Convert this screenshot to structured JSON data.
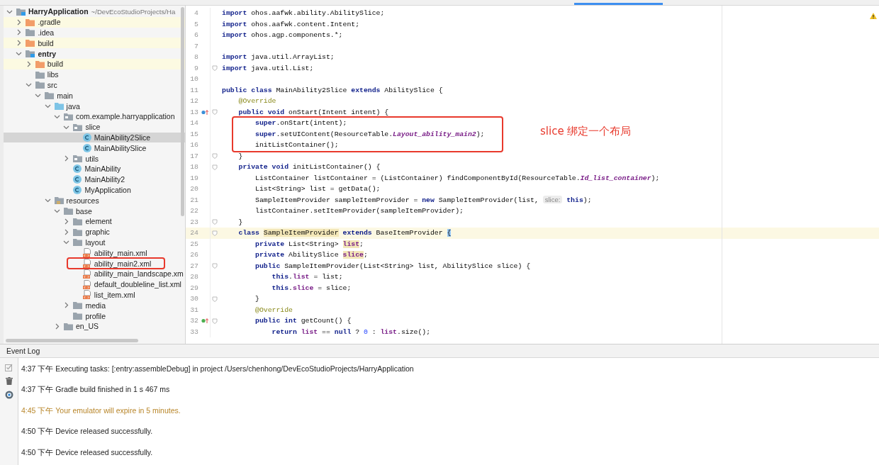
{
  "project_tree": {
    "items": [
      {
        "name": "HarryApplication",
        "path": "~/DevEcoStudioProjects/Ha",
        "kind": "module",
        "expanded": true,
        "selected": false,
        "children": [
          {
            "name": ".gradle",
            "kind": "excluded",
            "expanded": false,
            "selected": false
          },
          {
            "name": ".idea",
            "kind": "folder",
            "expanded": false,
            "selected": false
          },
          {
            "name": "build",
            "kind": "excluded",
            "expanded": false,
            "selected": false
          },
          {
            "name": "entry",
            "kind": "module",
            "expanded": true,
            "selected": false,
            "children": [
              {
                "name": "build",
                "kind": "excluded",
                "expanded": false,
                "selected": false
              },
              {
                "name": "libs",
                "kind": "folder",
                "selected": false
              },
              {
                "name": "src",
                "kind": "folder",
                "expanded": true,
                "selected": false,
                "children": [
                  {
                    "name": "main",
                    "kind": "folder",
                    "expanded": true,
                    "selected": false,
                    "children": [
                      {
                        "name": "java",
                        "kind": "source",
                        "expanded": true,
                        "selected": false,
                        "children": [
                          {
                            "name": "com.example.harryapplication",
                            "kind": "package",
                            "expanded": true,
                            "selected": false,
                            "children": [
                              {
                                "name": "slice",
                                "kind": "package",
                                "expanded": true,
                                "selected": false,
                                "children": [
                                  {
                                    "name": "MainAbility2Slice",
                                    "kind": "class",
                                    "selected": true
                                  },
                                  {
                                    "name": "MainAbilitySlice",
                                    "kind": "class",
                                    "selected": false
                                  }
                                ]
                              },
                              {
                                "name": "utils",
                                "kind": "package",
                                "expanded": false,
                                "selected": false
                              },
                              {
                                "name": "MainAbility",
                                "kind": "class",
                                "selected": false
                              },
                              {
                                "name": "MainAbility2",
                                "kind": "class",
                                "selected": false
                              },
                              {
                                "name": "MyApplication",
                                "kind": "class",
                                "selected": false
                              }
                            ]
                          }
                        ]
                      },
                      {
                        "name": "resources",
                        "kind": "resource",
                        "expanded": true,
                        "selected": false,
                        "children": [
                          {
                            "name": "base",
                            "kind": "folder",
                            "expanded": true,
                            "selected": false,
                            "children": [
                              {
                                "name": "element",
                                "kind": "folder",
                                "expanded": false,
                                "selected": false
                              },
                              {
                                "name": "graphic",
                                "kind": "folder",
                                "expanded": false,
                                "selected": false
                              },
                              {
                                "name": "layout",
                                "kind": "folder",
                                "expanded": true,
                                "selected": false,
                                "children": [
                                  {
                                    "name": "ability_main.xml",
                                    "kind": "xml",
                                    "selected": false
                                  },
                                  {
                                    "name": "ability_main2.xml",
                                    "kind": "xml",
                                    "selected": false,
                                    "boxed": true
                                  },
                                  {
                                    "name": "ability_main_landscape.xm",
                                    "kind": "xml",
                                    "selected": false
                                  },
                                  {
                                    "name": "default_doubleline_list.xml",
                                    "kind": "xml",
                                    "selected": false
                                  },
                                  {
                                    "name": "list_item.xml",
                                    "kind": "xml",
                                    "selected": false
                                  }
                                ]
                              },
                              {
                                "name": "media",
                                "kind": "folder",
                                "expanded": false,
                                "selected": false
                              },
                              {
                                "name": "profile",
                                "kind": "folder",
                                "selected": false
                              }
                            ]
                          },
                          {
                            "name": "en_US",
                            "kind": "folder",
                            "expanded": false,
                            "selected": false
                          }
                        ]
                      }
                    ]
                  }
                ]
              }
            ]
          }
        ]
      }
    ]
  },
  "editor": {
    "callout": "slice 绑定一个布局",
    "lines": [
      {
        "number": "4",
        "segments": [
          {
            "t": "import",
            "kind": "kw"
          },
          {
            "t": " ohos.aafwk.ability.AbilitySlice;",
            "kind": "p"
          }
        ]
      },
      {
        "number": "5",
        "segments": [
          {
            "t": "import",
            "kind": "kw"
          },
          {
            "t": " ohos.aafwk.content.Intent;",
            "kind": "p"
          }
        ]
      },
      {
        "number": "6",
        "segments": [
          {
            "t": "import",
            "kind": "kw"
          },
          {
            "t": " ohos.agp.components.*;",
            "kind": "p"
          }
        ]
      },
      {
        "number": "7"
      },
      {
        "number": "8",
        "segments": [
          {
            "t": "import",
            "kind": "kw"
          },
          {
            "t": " java.util.ArrayList;",
            "kind": "p"
          }
        ]
      },
      {
        "number": "9",
        "fold": true,
        "segments": [
          {
            "t": "import",
            "kind": "kw"
          },
          {
            "t": " java.util.List;",
            "kind": "p"
          }
        ]
      },
      {
        "number": "10"
      },
      {
        "number": "11",
        "segments": [
          {
            "t": "public class",
            "kind": "kw"
          },
          {
            "t": " MainAbility2Slice ",
            "kind": "p"
          },
          {
            "t": "extends",
            "kind": "kw"
          },
          {
            "t": " AbilitySlice {",
            "kind": "p"
          }
        ]
      },
      {
        "number": "12",
        "segments": [
          {
            "t": "    @Override",
            "kind": "ann"
          }
        ]
      },
      {
        "number": "13",
        "overrides": true,
        "fold": true,
        "segments": [
          {
            "t": "    public void",
            "kind": "kw"
          },
          {
            "t": " onStart(Intent intent) {",
            "kind": "p"
          }
        ]
      },
      {
        "number": "14",
        "boxed": true,
        "segments": [
          {
            "t": "        super",
            "kind": "kw"
          },
          {
            "t": ".onStart(intent);",
            "kind": "p"
          }
        ]
      },
      {
        "number": "15",
        "boxed": true,
        "segments": [
          {
            "t": "        super",
            "kind": "kw"
          },
          {
            "t": ".setUIContent(ResourceTable.",
            "kind": "p"
          },
          {
            "t": "Layout_ability_main2",
            "kind": "fld"
          },
          {
            "t": ");",
            "kind": "p"
          }
        ]
      },
      {
        "number": "16",
        "boxed": true,
        "segments": [
          {
            "t": "        initListContainer();",
            "kind": "p"
          }
        ]
      },
      {
        "number": "17",
        "fold": true,
        "segments": [
          {
            "t": "    }",
            "kind": "p"
          }
        ]
      },
      {
        "number": "18",
        "fold": true,
        "segments": [
          {
            "t": "    private void",
            "kind": "kw"
          },
          {
            "t": " initListContainer() {",
            "kind": "p"
          }
        ]
      },
      {
        "number": "19",
        "segments": [
          {
            "t": "        ListContainer listContainer = (ListContainer) findComponentById(ResourceTable.",
            "kind": "p"
          },
          {
            "t": "Id_list_container",
            "kind": "fld"
          },
          {
            "t": ");",
            "kind": "p"
          }
        ]
      },
      {
        "number": "20",
        "segments": [
          {
            "t": "        List<String> list = getData();",
            "kind": "p"
          }
        ]
      },
      {
        "number": "21",
        "segments": [
          {
            "t": "        SampleItemProvider sampleItemProvider = ",
            "kind": "p"
          },
          {
            "t": "new",
            "kind": "kw"
          },
          {
            "t": " SampleItemProvider(list, ",
            "kind": "p"
          },
          {
            "t": "slice:",
            "kind": "hint"
          },
          {
            "t": " this",
            "kind": "kw"
          },
          {
            "t": ");",
            "kind": "p"
          }
        ]
      },
      {
        "number": "22",
        "segments": [
          {
            "t": "        listContainer.setItemProvider(sampleItemProvider);",
            "kind": "p"
          }
        ]
      },
      {
        "number": "23",
        "fold": true,
        "segments": [
          {
            "t": "    }",
            "kind": "p"
          }
        ]
      },
      {
        "number": "24",
        "current": true,
        "fold": true,
        "segments": [
          {
            "t": "    class ",
            "kind": "kw"
          },
          {
            "t": "SampleItemProvider",
            "kind": "hl"
          },
          {
            "t": " extends",
            "kind": "kw"
          },
          {
            "t": " BaseItemProvider ",
            "kind": "p"
          },
          {
            "t": "{",
            "kind": "brace"
          }
        ]
      },
      {
        "number": "25",
        "segments": [
          {
            "t": "        private",
            "kind": "kw"
          },
          {
            "t": " List<String> ",
            "kind": "p"
          },
          {
            "t": "list",
            "kind": "hlf"
          },
          {
            "t": ";",
            "kind": "p"
          }
        ]
      },
      {
        "number": "26",
        "segments": [
          {
            "t": "        private",
            "kind": "kw"
          },
          {
            "t": " AbilitySlice ",
            "kind": "p"
          },
          {
            "t": "slice",
            "kind": "hlf"
          },
          {
            "t": ";",
            "kind": "p"
          }
        ]
      },
      {
        "number": "27",
        "fold": true,
        "segments": [
          {
            "t": "        public",
            "kind": "kw"
          },
          {
            "t": " SampleItemProvider(List<String> list, AbilitySlice slice) {",
            "kind": "p"
          }
        ]
      },
      {
        "number": "28",
        "segments": [
          {
            "t": "            this",
            "kind": "kw"
          },
          {
            "t": ".",
            "kind": "p"
          },
          {
            "t": "list",
            "kind": "mem"
          },
          {
            "t": " = list;",
            "kind": "p"
          }
        ]
      },
      {
        "number": "29",
        "segments": [
          {
            "t": "            this",
            "kind": "kw"
          },
          {
            "t": ".",
            "kind": "p"
          },
          {
            "t": "slice",
            "kind": "mem"
          },
          {
            "t": " = slice;",
            "kind": "p"
          }
        ]
      },
      {
        "number": "30",
        "fold": true,
        "segments": [
          {
            "t": "        }",
            "kind": "p"
          }
        ]
      },
      {
        "number": "31",
        "segments": [
          {
            "t": "        @Override",
            "kind": "ann"
          }
        ]
      },
      {
        "number": "32",
        "overrides": true,
        "fold": true,
        "segments": [
          {
            "t": "        public int",
            "kind": "kw"
          },
          {
            "t": " getCount() {",
            "kind": "p"
          }
        ]
      },
      {
        "number": "33",
        "segments": [
          {
            "t": "            return ",
            "kind": "kw"
          },
          {
            "t": "list",
            "kind": "mem"
          },
          {
            "t": " == ",
            "kind": "p"
          },
          {
            "t": "null",
            "kind": "kw"
          },
          {
            "t": " ? ",
            "kind": "p"
          },
          {
            "t": "0",
            "kind": "num"
          },
          {
            "t": " : ",
            "kind": "p"
          },
          {
            "t": "list",
            "kind": "mem"
          },
          {
            "t": ".size();",
            "kind": "p"
          }
        ]
      }
    ]
  },
  "event_log": {
    "title": "Event Log",
    "entries": [
      {
        "time": "4:37 下午",
        "message": "Executing tasks: [:entry:assembleDebug] in project /Users/chenhong/DevEcoStudioProjects/HarryApplication",
        "kind": "info"
      },
      {
        "time": "4:37 下午",
        "message": "Gradle build finished in 1 s 467 ms",
        "kind": "info"
      },
      {
        "time": "4:45 下午",
        "message": "Your emulator will expire in 5 minutes.",
        "kind": "warning"
      },
      {
        "time": "4:50 下午",
        "message": "Device released successfully.",
        "kind": "info"
      },
      {
        "time": "4:50 下午",
        "message": "Device released successfully.",
        "kind": "info"
      }
    ]
  }
}
